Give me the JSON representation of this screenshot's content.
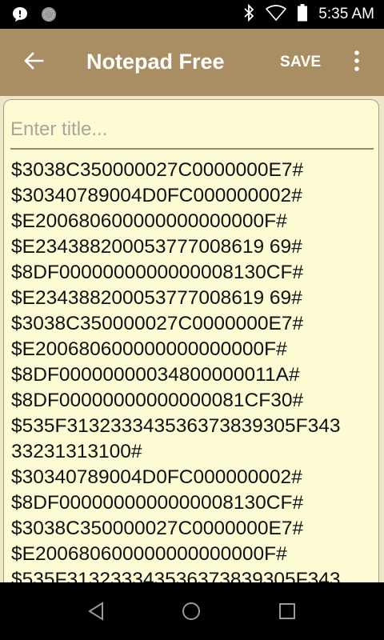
{
  "status_bar": {
    "time": "5:35 AM",
    "left_icons": [
      "message-notification-icon",
      "circle-notification-icon"
    ],
    "right_icons": [
      "bluetooth-icon",
      "wifi-icon",
      "battery-icon"
    ]
  },
  "app_bar": {
    "title": "Notepad Free",
    "save_label": "SAVE",
    "back_icon": "arrow-back-icon",
    "overflow_icon": "more-vert-icon",
    "background": "#a98e64"
  },
  "note": {
    "title_placeholder": "Enter title...",
    "title_value": "",
    "lines": [
      "$3038C350000027C0000000E7#",
      "$30340789004D0FC000000002#",
      "$E200680600000000000000F#",
      "$E234388200053777008619 69#",
      "$8DF0000000000000008130CF#",
      "$E234388200053777008619 69#",
      "$3038C350000027C0000000E7#",
      "$E200680600000000000000F#",
      "$8DF00000000034800000011A#",
      "$8DF00000000000000081CF30#",
      "$535F313233343536373839305F343",
      "33231313100#",
      "$30340789004D0FC000000002#",
      "$8DF0000000000000008130CF#",
      "$3038C350000027C0000000E7#",
      "$E200680600000000000000F#",
      "$535F313233343536373839305F343"
    ]
  },
  "nav_bar": {
    "icons": [
      "back-triangle-icon",
      "home-circle-icon",
      "recents-square-icon"
    ]
  }
}
